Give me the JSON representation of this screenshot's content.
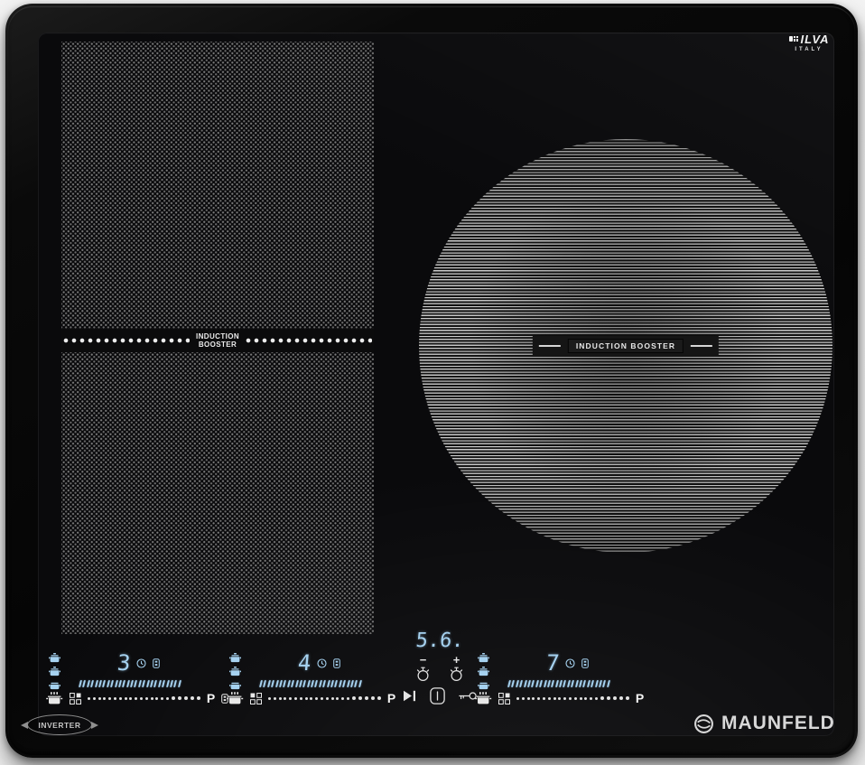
{
  "brand": {
    "ilva_name": "ILVA",
    "ilva_country": "ITALY",
    "maunfeld_name": "MAUNFELD",
    "inverter_badge": "INVERTER"
  },
  "surface": {
    "flex_zone_booster": {
      "line1": "INDUCTION",
      "line2": "BOOSTER"
    },
    "circle_zone_booster": "INDUCTION  BOOSTER"
  },
  "panel": {
    "zones": [
      {
        "name": "front-left",
        "level": "3",
        "boost_label": "P"
      },
      {
        "name": "rear-left",
        "level": "4",
        "boost_label": "P"
      },
      {
        "name": "right",
        "level": "7",
        "boost_label": "P"
      }
    ],
    "timer": {
      "display": "5.6.",
      "minus": "−",
      "plus": "+"
    },
    "scale_tick_count": 26,
    "slider_dot_count": 21
  },
  "colors": {
    "accent_blue": "#a6d2f0",
    "icon_white": "#e8e8e8",
    "glass_black": "#0a0a0c"
  }
}
